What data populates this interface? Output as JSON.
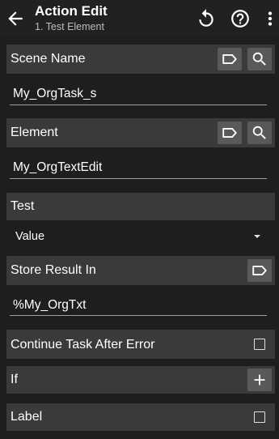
{
  "appbar": {
    "title": "Action Edit",
    "subtitle": "1. Test Element",
    "icons": [
      "back-arrow-icon",
      "reset-icon",
      "help-icon",
      "more-vert-icon"
    ]
  },
  "scene_name": {
    "label": "Scene Name",
    "value": "My_OrgTask_s"
  },
  "element": {
    "label": "Element",
    "value": "My_OrgTextEdit"
  },
  "test": {
    "label": "Test",
    "selected": "Value"
  },
  "store_result": {
    "label": "Store Result In",
    "value": "%My_OrgTxt"
  },
  "continue_after_error": {
    "label": "Continue Task After Error",
    "checked": false
  },
  "if": {
    "label": "If"
  },
  "label_row": {
    "label": "Label",
    "checked": false
  },
  "colors": {
    "background": "#1e1e1e",
    "appbar": "#212121",
    "section": "#3a3a3a",
    "icon_button": "#595959",
    "underline": "#9e9e9e"
  }
}
